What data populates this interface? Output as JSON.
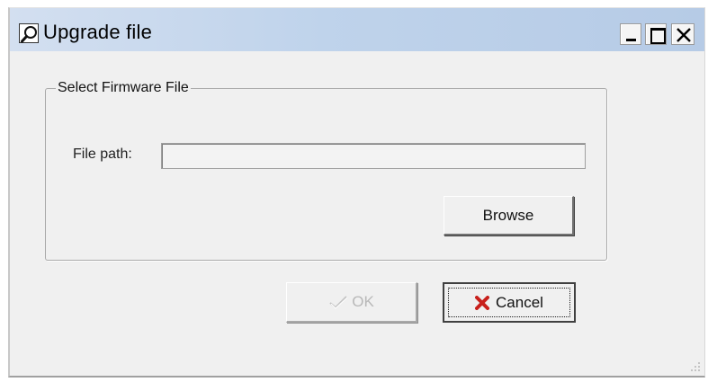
{
  "window": {
    "title": "Upgrade file",
    "icons": {
      "app": "magnifier-icon",
      "minimize": "minimize-icon",
      "maximize": "maximize-icon",
      "close": "close-icon"
    }
  },
  "group": {
    "legend": "Select Firmware File",
    "file_path_label": "File path:",
    "file_path_value": "",
    "browse_label": "Browse"
  },
  "buttons": {
    "ok_label": "OK",
    "ok_enabled": false,
    "cancel_label": "Cancel",
    "ok_icon": "checkmark-icon",
    "cancel_icon": "red-x-icon"
  },
  "colors": {
    "titlebar": "#bfd3eb",
    "dialog_background": "#f0f0f0",
    "cancel_icon": "#c8201c",
    "disabled_text": "#b8b8b8"
  }
}
